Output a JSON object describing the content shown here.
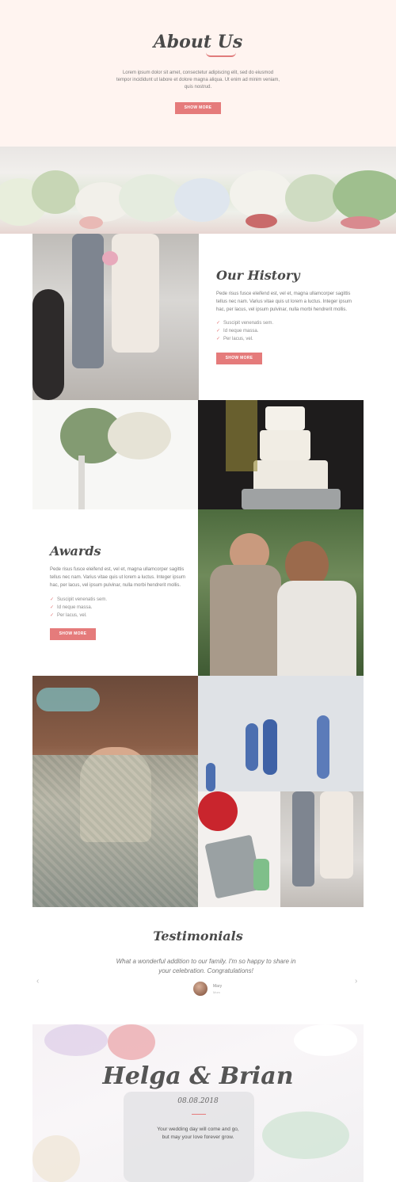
{
  "about": {
    "title": "About Us",
    "text": "Lorem ipsum dolor sit amet, consectetur adipiscing elit, sed do eiusmod tempor incididunt ut labore et dolore magna aliqua. Ut enim ad minim veniam, quis nostrud.",
    "button": "SHOW MORE"
  },
  "history": {
    "title": "Our History",
    "text": "Pede risus fusce eleifend est, vel et, magna ullamcorper sagittis tellus nec nam. Varius vitae quis ut lorem a luctus. Integer ipsum hac, per lacus, vel ipsum pulvinar, nulla morbi hendrerit mollis.",
    "items": [
      "Suscipit venenatis sem.",
      "Id neque massa.",
      "Per lacus, vel."
    ],
    "button": "SHOW MORE"
  },
  "awards": {
    "title": "Awards",
    "text": "Pede risus fusce eleifend est, vel et, magna ullamcorper sagittis tellus nec nam. Varius vitae quis ut lorem a luctus. Integer ipsum hac, per lacus, vel ipsum pulvinar, nulla morbi hendrerit mollis.",
    "items": [
      "Suscipit venenatis sem.",
      "Id neque massa.",
      "Per lacus, vel."
    ],
    "button": "SHOW MORE"
  },
  "testimonials": {
    "title": "Testimonials",
    "quote": "What a wonderful addition to our family. I'm so happy to share in your celebration. Congratulations!",
    "author": "Mary",
    "author_sub": "Mom",
    "prev": "‹",
    "next": "›"
  },
  "savedate": {
    "names": "Helga & Brian",
    "date": "08.08.2018",
    "line1": "Your wedding day will come and go,",
    "line2": "but may your love forever grow."
  },
  "colors": {
    "accent": "#e57b7b",
    "hero_bg": "#fff4f0"
  }
}
